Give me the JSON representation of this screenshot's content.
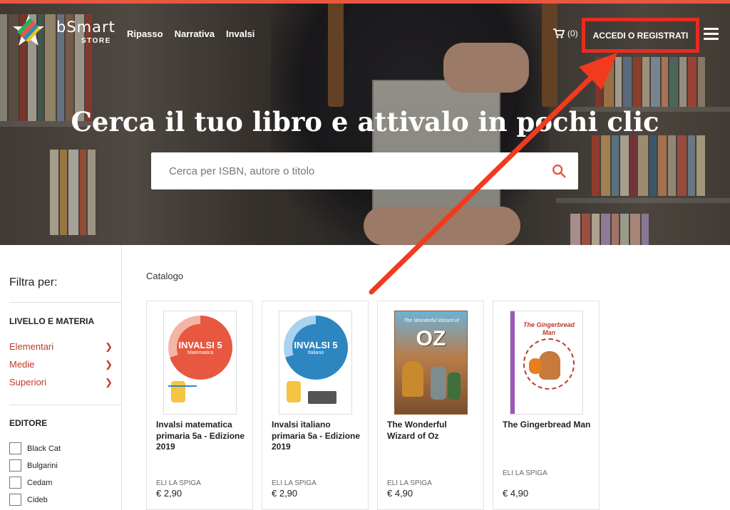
{
  "brand": {
    "name": "bSmart",
    "sub": "STORE"
  },
  "nav": {
    "items": [
      "Ripasso",
      "Narrativa",
      "Invalsi"
    ]
  },
  "cart": {
    "count": "(0)",
    "icon": "cart-icon"
  },
  "header": {
    "login_label": "ACCEDI O REGISTRATI",
    "menu_icon": "hamburger-menu-icon"
  },
  "hero": {
    "title": "Cerca il tuo libro e attivalo in pochi clic",
    "search_placeholder": "Cerca per ISBN, autore o titolo"
  },
  "sidebar": {
    "filter_title": "Filtra per:",
    "level_section": "LIVELLO E MATERIA",
    "levels": [
      "Elementari",
      "Medie",
      "Superiori"
    ],
    "editor_section": "EDITORE",
    "editors": [
      "Black Cat",
      "Bulgarini",
      "Cedam",
      "Cideb"
    ]
  },
  "catalog": {
    "label": "Catalogo",
    "products": [
      {
        "title": "Invalsi matematica primaria 5a - Edizione 2019",
        "publisher": "ELI LA SPIGA",
        "price": "€ 2,90",
        "cover_text": "INVALSI 5",
        "cover_sub": "Matematica"
      },
      {
        "title": "Invalsi italiano primaria 5a - Edizione 2019",
        "publisher": "ELI LA SPIGA",
        "price": "€ 2,90",
        "cover_text": "INVALSI 5",
        "cover_sub": "Italiano"
      },
      {
        "title": "The Wonderful Wizard of Oz",
        "publisher": "ELI LA SPIGA",
        "price": "€ 4,90",
        "cover_text": "OZ",
        "cover_sub": "The Wonderful Wizard of"
      },
      {
        "title": "The Gingerbread Man",
        "publisher": "ELI LA SPIGA",
        "price": "€ 4,90",
        "cover_text": "The Gingerbread Man",
        "cover_sub": ""
      }
    ]
  },
  "colors": {
    "accent_red": "#c0392b",
    "highlight_red": "#ec2a1f",
    "stripe": "#e8573f"
  }
}
